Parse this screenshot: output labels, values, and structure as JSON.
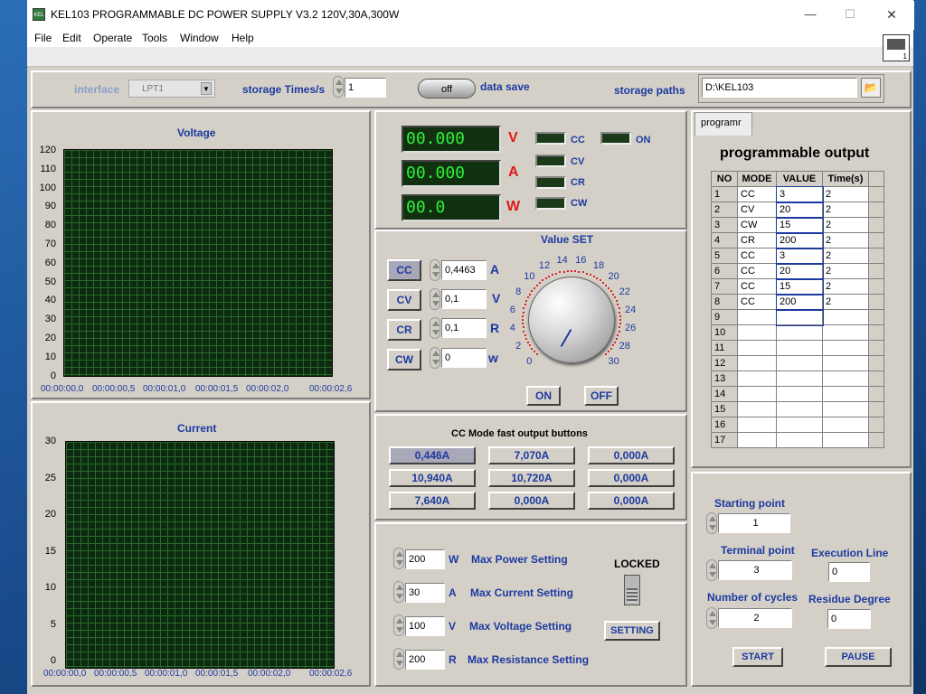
{
  "window": {
    "title": "KEL103 PROGRAMMABLE DC POWER SUPPLY V3.2  120V,30A,300W",
    "icon_label": "KEL",
    "min": "—",
    "max": "☐",
    "close": "✕"
  },
  "menu": [
    "File",
    "Edit",
    "Operate",
    "Tools",
    "Window",
    "Help"
  ],
  "vi_number": "1",
  "top": {
    "interface_label": "interface",
    "interface_value": "LPT1",
    "storage_label": "storage Times/s",
    "storage_value": "1",
    "toggle": "off",
    "data_save_label": "data save",
    "paths_label": "storage paths",
    "path_value": "D:\\KEL103"
  },
  "voltage_graph": {
    "title": "Voltage",
    "yticks": [
      "120",
      "110",
      "100",
      "90",
      "80",
      "70",
      "60",
      "50",
      "40",
      "30",
      "20",
      "10",
      "0"
    ],
    "xticks": [
      "00:00:00,0",
      "00:00:00,5",
      "00:00:01,0",
      "00:00:01,5",
      "00:00:02,0",
      "00:00:02,6"
    ]
  },
  "current_graph": {
    "title": "Current",
    "yticks": [
      "30",
      "25",
      "20",
      "15",
      "10",
      "5",
      "0"
    ],
    "xticks": [
      "00:00:00,0",
      "00:00:00,5",
      "00:00:01,0",
      "00:00:01,5",
      "00:00:02,0",
      "00:00:02,6"
    ]
  },
  "readout": {
    "voltage": "00.000",
    "voltage_unit": "V",
    "current": "00.000",
    "current_unit": "A",
    "power": "00.0",
    "power_unit": "W",
    "ind_cc": "CC",
    "ind_cv": "CV",
    "ind_cr": "CR",
    "ind_cw": "CW",
    "ind_on": "ON"
  },
  "value_set": {
    "title": "Value SET",
    "cc_btn": "CC",
    "cc_val": "0,4463",
    "cc_unit": "A",
    "cv_btn": "CV",
    "cv_val": "0,1",
    "cv_unit": "V",
    "cr_btn": "CR",
    "cr_val": "0,1",
    "cr_unit": "R",
    "cw_btn": "CW",
    "cw_val": "0",
    "cw_unit": "w",
    "dial_labels": [
      "0",
      "2",
      "4",
      "6",
      "8",
      "10",
      "12",
      "14",
      "16",
      "18",
      "20",
      "22",
      "24",
      "26",
      "28",
      "30"
    ],
    "on_btn": "ON",
    "off_btn": "OFF"
  },
  "fast": {
    "title": "CC Mode fast output buttons",
    "buttons": [
      "0,446A",
      "7,070A",
      "0,000A",
      "10,940A",
      "10,720A",
      "0,000A",
      "7,640A",
      "0,000A",
      "0,000A"
    ]
  },
  "settings": {
    "power_val": "200",
    "power_unit": "W",
    "power_label": "Max Power Setting",
    "current_val": "30",
    "current_unit": "A",
    "current_label": "Max Current Setting",
    "voltage_val": "100",
    "voltage_unit": "V",
    "voltage_label": "Max Voltage Setting",
    "res_val": "200",
    "res_unit": "R",
    "res_label": "Max Resistance Setting",
    "locked_label": "LOCKED",
    "setting_btn": "SETTING"
  },
  "program": {
    "tab": "programr",
    "title": "programmable output",
    "headers": [
      "NO",
      "MODE",
      "VALUE",
      "Time(s)"
    ],
    "rows": [
      [
        "1",
        "CC",
        "3",
        "2"
      ],
      [
        "2",
        "CV",
        "20",
        "2"
      ],
      [
        "3",
        "CW",
        "15",
        "2"
      ],
      [
        "4",
        "CR",
        "200",
        "2"
      ],
      [
        "5",
        "CC",
        "3",
        "2"
      ],
      [
        "6",
        "CC",
        "20",
        "2"
      ],
      [
        "7",
        "CC",
        "15",
        "2"
      ],
      [
        "8",
        "CC",
        "200",
        "2"
      ],
      [
        "9",
        "",
        "",
        ""
      ],
      [
        "10",
        "",
        "",
        ""
      ],
      [
        "11",
        "",
        "",
        ""
      ],
      [
        "12",
        "",
        "",
        ""
      ],
      [
        "13",
        "",
        "",
        ""
      ],
      [
        "14",
        "",
        "",
        ""
      ],
      [
        "15",
        "",
        "",
        ""
      ],
      [
        "16",
        "",
        "",
        ""
      ],
      [
        "17",
        "",
        "",
        ""
      ]
    ]
  },
  "cycle": {
    "start_label": "Starting point",
    "start_val": "1",
    "term_label": "Terminal point",
    "term_val": "3",
    "exec_label": "Execution Line",
    "exec_val": "0",
    "cycles_label": "Number of cycles",
    "cycles_val": "2",
    "residue_label": "Residue Degree",
    "residue_val": "0",
    "start_btn": "START",
    "pause_btn": "PAUSE"
  }
}
